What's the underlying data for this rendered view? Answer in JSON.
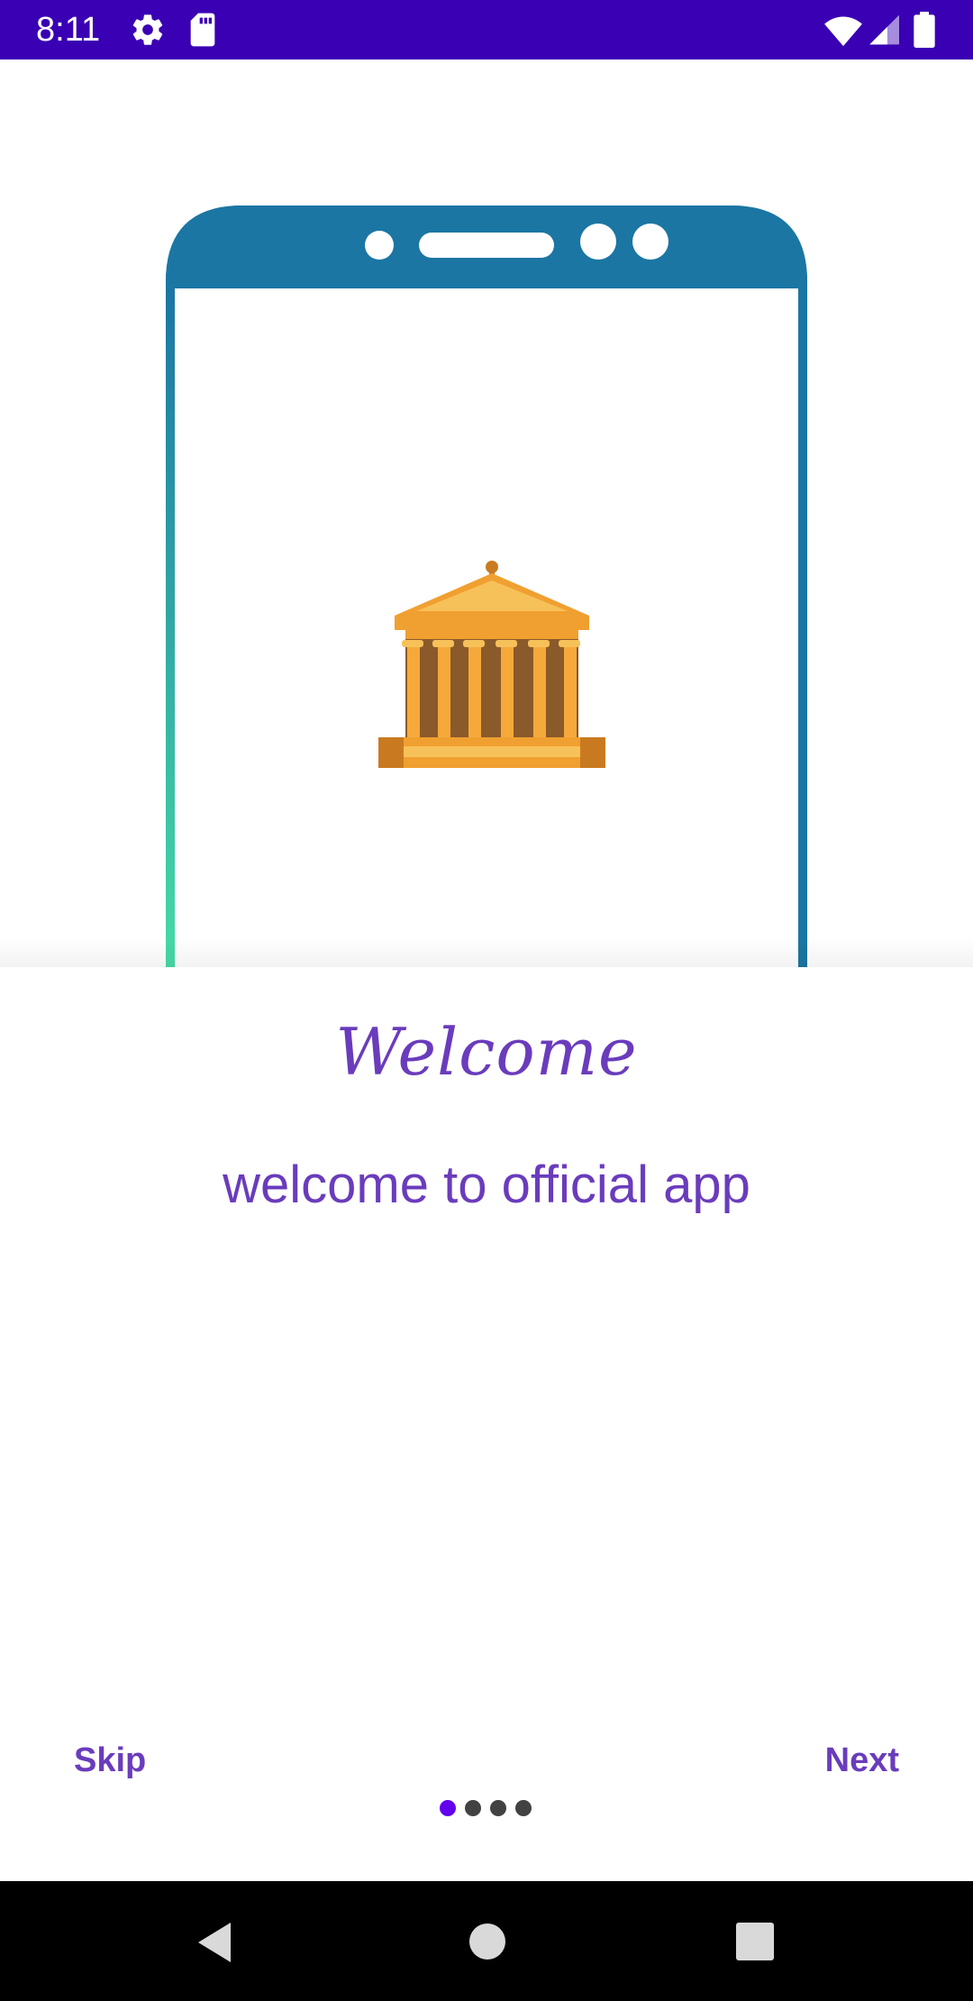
{
  "status_bar": {
    "time": "8:11",
    "icons": [
      "gear-icon",
      "sd-card-icon",
      "wifi-icon",
      "signal-icon",
      "battery-icon"
    ],
    "background": "#3a00b3"
  },
  "onboarding": {
    "title": "Welcome",
    "subtitle": "welcome to official app",
    "illustration": "phone-with-bank-building",
    "accent_color": "#6a3cbc",
    "skip_label": "Skip",
    "next_label": "Next",
    "page_indicator": {
      "total": 4,
      "current": 1
    }
  },
  "nav_bar": {
    "buttons": [
      "back-icon",
      "home-icon",
      "recents-icon"
    ]
  }
}
